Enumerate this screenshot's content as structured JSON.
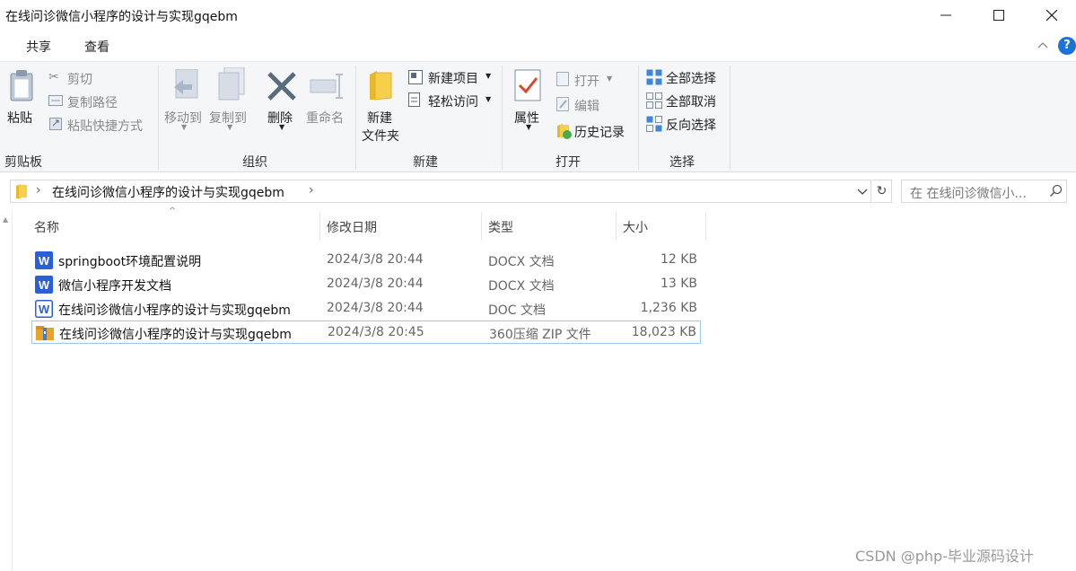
{
  "window": {
    "title": "在线问诊微信小程序的设计与实现gqebm"
  },
  "ribbon_tabs": [
    "共享",
    "查看"
  ],
  "help": "?",
  "ribbon": {
    "clipboard": {
      "paste": "粘贴",
      "cut": "剪切",
      "copy_path": "复制路径",
      "paste_shortcut": "粘贴快捷方式",
      "group": "剪贴板"
    },
    "organize": {
      "move_to": "移动到",
      "copy_to": "复制到",
      "delete": "删除",
      "rename": "重命名",
      "group": "组织"
    },
    "new": {
      "new_folder_line1": "新建",
      "new_folder_line2": "文件夹",
      "new_item": "新建项目",
      "easy_access": "轻松访问",
      "group": "新建"
    },
    "open": {
      "properties": "属性",
      "open": "打开",
      "edit": "编辑",
      "history": "历史记录",
      "group": "打开"
    },
    "select": {
      "select_all": "全部选择",
      "select_none": "全部取消",
      "invert": "反向选择",
      "group": "选择"
    }
  },
  "address": {
    "path": "在线问诊微信小程序的设计与实现gqebm",
    "search_placeholder": "在 在线问诊微信小..."
  },
  "columns": [
    "名称",
    "修改日期",
    "类型",
    "大小"
  ],
  "files": [
    {
      "name": "springboot环境配置说明",
      "date": "2024/3/8 20:44",
      "type": "DOCX 文档",
      "size": "12 KB",
      "icon": "word-docx-icon"
    },
    {
      "name": "微信小程序开发文档",
      "date": "2024/3/8 20:44",
      "type": "DOCX 文档",
      "size": "13 KB",
      "icon": "word-docx-icon"
    },
    {
      "name": "在线问诊微信小程序的设计与实现gqebm",
      "date": "2024/3/8 20:44",
      "type": "DOC 文档",
      "size": "1,236 KB",
      "icon": "word-doc-icon"
    },
    {
      "name": "在线问诊微信小程序的设计与实现gqebm",
      "date": "2024/3/8 20:45",
      "type": "360压缩 ZIP 文件",
      "size": "18,023 KB",
      "icon": "zip-archive-icon"
    }
  ],
  "watermark": "CSDN @php-毕业源码设计",
  "colors": {
    "accent": "#1a73d8",
    "selection_border": "#99c8f0",
    "word_blue": "#2b5fd9",
    "ribbon_bg": "#f5f6f7"
  }
}
